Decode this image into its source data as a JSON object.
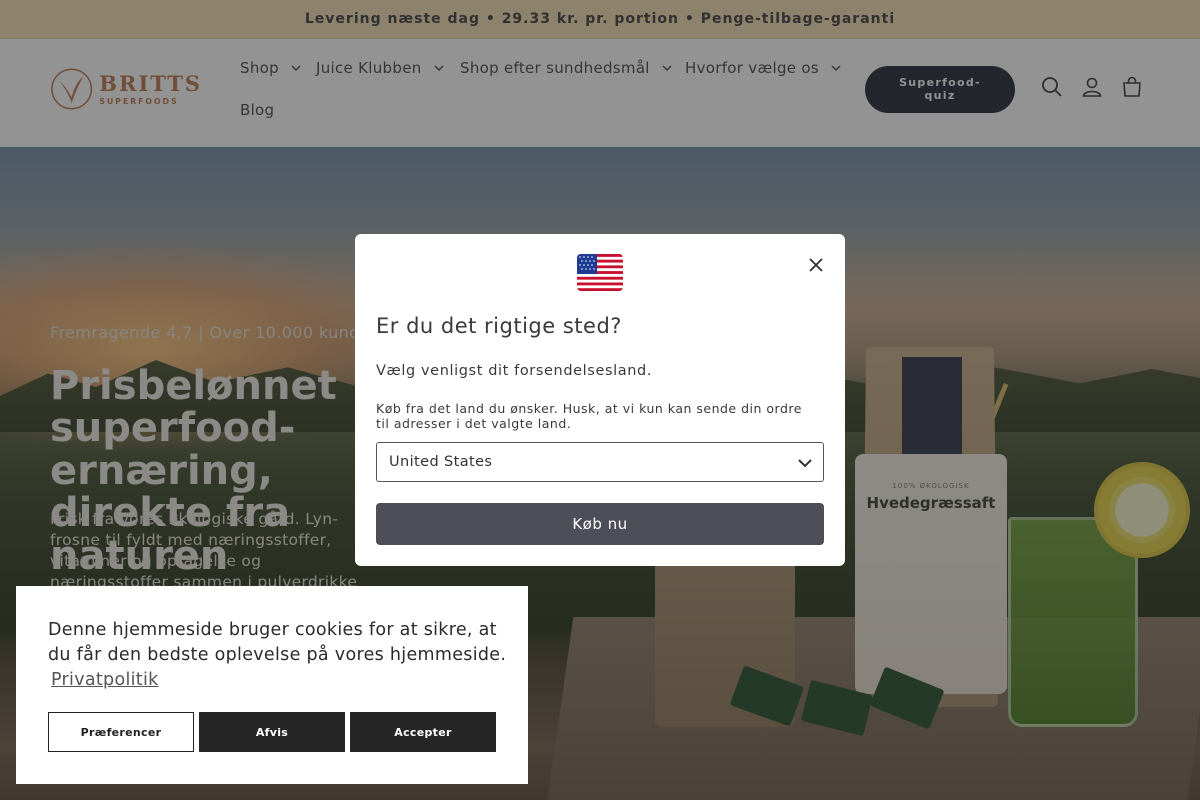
{
  "announcement": "Levering næste dag • 29.33 kr. pr. portion • Penge-tilbage-garanti",
  "brand": {
    "line1": "BRITTS",
    "line2": "SUPERFOODS",
    "accent": "#b8744a"
  },
  "nav": {
    "items": [
      {
        "label": "Shop",
        "dropdown": true
      },
      {
        "label": "Juice Klubben",
        "dropdown": true
      },
      {
        "label": "Shop efter sundhedsmål",
        "dropdown": true
      },
      {
        "label": "Hvorfor vælge os",
        "dropdown": true
      },
      {
        "label": "Blog",
        "dropdown": false
      }
    ],
    "quiz_button": "Superfood-quiz",
    "icons": [
      "search-icon",
      "account-icon",
      "cart-icon"
    ]
  },
  "hero": {
    "rating": "Fremragende 4,7 | Over 10.000 kunder",
    "title": "Prisbelønnet superfood-ernæring, direkte fra naturen",
    "subtitle": "Frisk fra vores økologiske gård. Lyn-frosne til fyldt med næringsstoffer, vitaminer og optagelse og næringsstoffer sammen i pulverdrikke",
    "product_label": "Hvedegræssaft",
    "product_tag": "100% ØKOLOGISK"
  },
  "modal": {
    "flag": "us-flag-icon",
    "title": "Er du det rigtige sted?",
    "lead": "Vælg venligst dit forsendelsesland.",
    "note": "Køb fra det land du ønsker. Husk, at vi kun kan sende din ordre til adresser i det valgte land.",
    "country_selected": "United States",
    "buy_button": "Køb nu"
  },
  "cookie": {
    "text": "Denne hjemmeside bruger cookies for at sikre, at du får den bedste oplevelse på vores hjemmeside.",
    "link": "Privatpolitik",
    "buttons": {
      "preferences": "Præferencer",
      "deny": "Afvis",
      "accept": "Accepter"
    }
  }
}
